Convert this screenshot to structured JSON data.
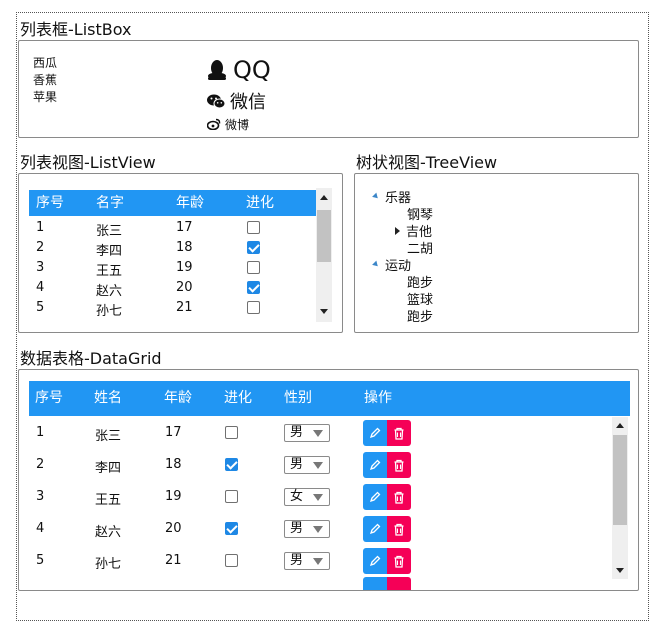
{
  "listbox": {
    "title": "列表框-ListBox",
    "items": [
      "西瓜",
      "香蕉",
      "苹果"
    ],
    "rich_items": [
      {
        "icon": "qq-penguin-icon",
        "label": "QQ"
      },
      {
        "icon": "wechat-icon",
        "label": "微信"
      },
      {
        "icon": "weibo-icon",
        "label": "微博"
      }
    ]
  },
  "listview": {
    "title": "列表视图-ListView",
    "columns": [
      "序号",
      "名字",
      "年龄",
      "进化"
    ],
    "rows": [
      {
        "id": "1",
        "name": "张三",
        "age": "17",
        "evolved": false
      },
      {
        "id": "2",
        "name": "李四",
        "age": "18",
        "evolved": true
      },
      {
        "id": "3",
        "name": "王五",
        "age": "19",
        "evolved": false
      },
      {
        "id": "4",
        "name": "赵六",
        "age": "20",
        "evolved": true
      },
      {
        "id": "5",
        "name": "孙七",
        "age": "21",
        "evolved": false
      }
    ]
  },
  "treeview": {
    "title": "树状视图-TreeView",
    "nodes": [
      {
        "label": "乐器",
        "expanded": true,
        "children": [
          {
            "label": "钢琴"
          },
          {
            "label": "吉他",
            "expanded": false
          },
          {
            "label": "二胡"
          }
        ]
      },
      {
        "label": "运动",
        "expanded": true,
        "children": [
          {
            "label": "跑步"
          },
          {
            "label": "篮球"
          },
          {
            "label": "跑步"
          }
        ]
      }
    ]
  },
  "datagrid": {
    "title": "数据表格-DataGrid",
    "columns": [
      "序号",
      "姓名",
      "年龄",
      "进化",
      "性别",
      "操作"
    ],
    "rows": [
      {
        "id": "1",
        "name": "张三",
        "age": "17",
        "evolved": false,
        "gender": "男"
      },
      {
        "id": "2",
        "name": "李四",
        "age": "18",
        "evolved": true,
        "gender": "男"
      },
      {
        "id": "3",
        "name": "王五",
        "age": "19",
        "evolved": false,
        "gender": "女"
      },
      {
        "id": "4",
        "name": "赵六",
        "age": "20",
        "evolved": true,
        "gender": "男"
      },
      {
        "id": "5",
        "name": "孙七",
        "age": "21",
        "evolved": false,
        "gender": "男"
      }
    ],
    "actions": {
      "edit_icon": "pencil-icon",
      "delete_icon": "trash-icon"
    }
  },
  "colors": {
    "accent": "#2196f3",
    "danger": "#f50057",
    "checkbox": "#1e88e5"
  }
}
